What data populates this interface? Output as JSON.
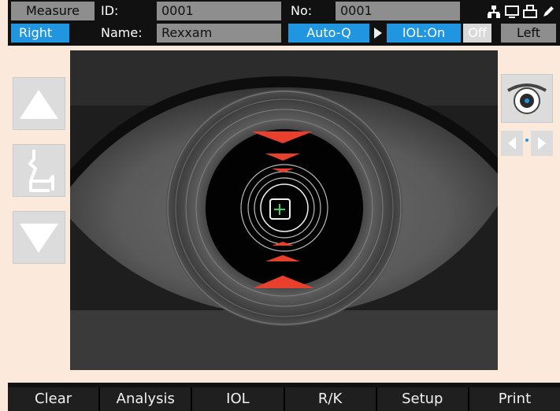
{
  "header": {
    "mode_label": "Measure",
    "id_label": "ID:",
    "id_value": "0001",
    "no_label": "No:",
    "no_value": "0001",
    "eye_right": "Right",
    "name_label": "Name:",
    "name_value": "Rexxam",
    "autoq_label": "Auto-Q",
    "iol_label": "IOL:On",
    "off_label": "Off",
    "eye_left": "Left",
    "status_icons": [
      "network-icon",
      "monitor-icon",
      "printer-icon",
      "pen-icon"
    ]
  },
  "side_controls": {
    "up_icon": "triangle-up-icon",
    "chinrest_icon": "chinrest-icon",
    "down_icon": "triangle-down-icon",
    "eye_view_icon": "eye-view-icon",
    "left_arrow_icon": "arrow-left-icon",
    "right_arrow_icon": "arrow-right-icon"
  },
  "footer": {
    "buttons": [
      "Clear",
      "Analysis",
      "IOL",
      "R/K",
      "Setup",
      "Print"
    ]
  },
  "colors": {
    "accent_blue": "#2196e0",
    "field_grey": "#8e8e8e",
    "marker_red": "#e8402c",
    "crosshair_green": "#3fd35a"
  }
}
